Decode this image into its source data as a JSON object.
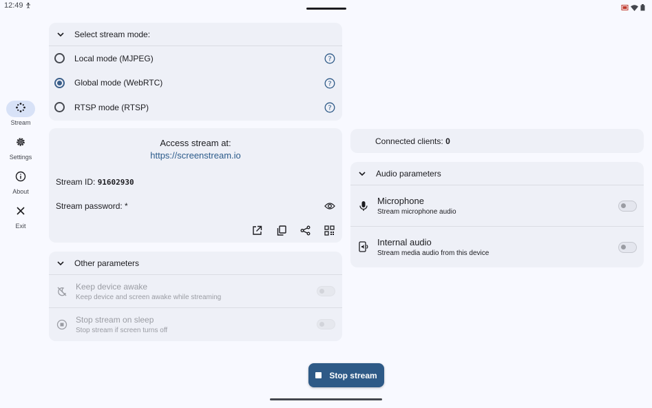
{
  "status": {
    "time": "12:49"
  },
  "nav": {
    "items": [
      {
        "label": "Stream",
        "icon": "stream-icon",
        "active": true
      },
      {
        "label": "Settings",
        "icon": "gear-icon"
      },
      {
        "label": "About",
        "icon": "info-icon"
      },
      {
        "label": "Exit",
        "icon": "close-icon"
      }
    ]
  },
  "stream_mode": {
    "header": "Select stream mode:",
    "options": [
      {
        "label": "Local mode (MJPEG)",
        "selected": false
      },
      {
        "label": "Global mode (WebRTC)",
        "selected": true
      },
      {
        "label": "RTSP mode (RTSP)",
        "selected": false
      }
    ]
  },
  "access": {
    "title": "Access stream at:",
    "link": "https://screenstream.io",
    "stream_id_label": "Stream ID: ",
    "stream_id": "91602930",
    "password_label": "Stream password: ",
    "password": "*"
  },
  "other_params": {
    "header": "Other parameters",
    "items": [
      {
        "title": "Keep device awake",
        "subtitle": "Keep device and screen awake while streaming",
        "enabled": false
      },
      {
        "title": "Stop stream on sleep",
        "subtitle": "Stop stream if screen turns off",
        "enabled": false
      }
    ]
  },
  "clients": {
    "label": "Connected clients: ",
    "count": "0"
  },
  "audio": {
    "header": "Audio parameters",
    "items": [
      {
        "title": "Microphone",
        "subtitle": "Stream microphone audio",
        "on": false
      },
      {
        "title": "Internal audio",
        "subtitle": "Stream media audio from this device",
        "on": false
      }
    ]
  },
  "stop_button": {
    "label": "Stop stream"
  },
  "colors": {
    "accent": "#2e5a87",
    "link": "#2a5a8a",
    "card": "#eef0f7",
    "background": "#f8f9ff"
  }
}
